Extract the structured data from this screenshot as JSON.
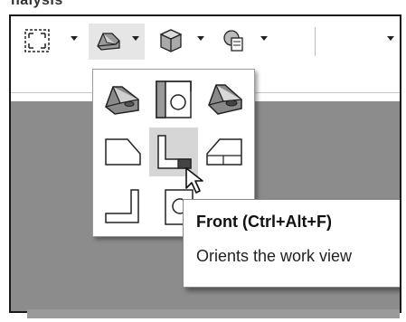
{
  "top_label": "nalysis",
  "toolbar": {
    "items": [
      {
        "icon": "zoom-fit-icon"
      },
      {
        "icon": "view-orientation-icon",
        "selected": true
      },
      {
        "icon": "display-style-icon"
      },
      {
        "icon": "hide-show-icon"
      },
      {
        "icon": "more-icon"
      }
    ]
  },
  "flyout": {
    "items": [
      {
        "icon": "isometric-view-icon",
        "name": "Isometric"
      },
      {
        "icon": "top-view-icon",
        "name": "Top"
      },
      {
        "icon": "trimetric-view-icon",
        "name": "Trimetric"
      },
      {
        "icon": "left-view-icon",
        "name": "Left"
      },
      {
        "icon": "front-view-icon",
        "name": "Front",
        "hovered": true
      },
      {
        "icon": "right-view-icon",
        "name": "Right"
      },
      {
        "icon": "bottom-view-icon",
        "name": "Bottom"
      },
      {
        "icon": "back-view-icon",
        "name": "Back"
      }
    ]
  },
  "tooltip": {
    "title": "Front (Ctrl+Alt+F)",
    "description": "Orients the work view"
  },
  "colors": {
    "graphics_area": "#8c8c8c",
    "hover": "#d6d6d6",
    "selected": "#e6e6e6"
  }
}
